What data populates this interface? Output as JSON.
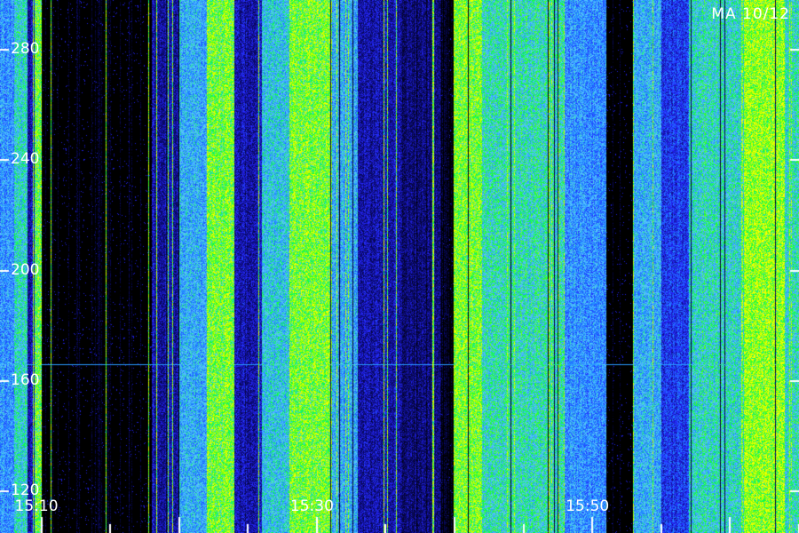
{
  "chart_data": {
    "type": "heatmap",
    "title": "",
    "corner_label": "MA 10/12",
    "xlabel": "",
    "ylabel": "",
    "x_ticks": [
      "15:10",
      "15:30",
      "15:50"
    ],
    "y_ticks": [
      280,
      240,
      200,
      160,
      120
    ],
    "ylim": [
      105,
      298
    ],
    "xlim_minutes": [
      "15:07",
      "16:05"
    ],
    "grid": false,
    "colormap": [
      "#000000",
      "#0a0a6e",
      "#2626ff",
      "#1e90ff",
      "#5fc8ff",
      "#00ff40",
      "#b0ff00",
      "#ffff00"
    ],
    "bands": [
      {
        "x_start": "15:07",
        "x_end": "15:08",
        "intensity": 0.45
      },
      {
        "x_start": "15:08",
        "x_end": "15:09",
        "intensity": 0.6
      },
      {
        "x_start": "15:09",
        "x_end": "15:09:30",
        "intensity": 0.2
      },
      {
        "x_start": "15:09:30",
        "x_end": "15:10",
        "intensity": 0.75
      },
      {
        "x_start": "15:10",
        "x_end": "15:18",
        "intensity": 0.02
      },
      {
        "x_start": "15:18",
        "x_end": "15:20",
        "intensity": 0.2
      },
      {
        "x_start": "15:20",
        "x_end": "15:22",
        "intensity": 0.5
      },
      {
        "x_start": "15:22",
        "x_end": "15:24",
        "intensity": 0.8
      },
      {
        "x_start": "15:24",
        "x_end": "15:26",
        "intensity": 0.2
      },
      {
        "x_start": "15:26",
        "x_end": "15:28",
        "intensity": 0.55
      },
      {
        "x_start": "15:28",
        "x_end": "15:31",
        "intensity": 0.8
      },
      {
        "x_start": "15:31",
        "x_end": "15:33",
        "intensity": 0.5
      },
      {
        "x_start": "15:33",
        "x_end": "15:36",
        "intensity": 0.2
      },
      {
        "x_start": "15:36",
        "x_end": "15:39",
        "intensity": 0.15
      },
      {
        "x_start": "15:39",
        "x_end": "15:40",
        "intensity": 0.05
      },
      {
        "x_start": "15:40",
        "x_end": "15:42",
        "intensity": 0.8
      },
      {
        "x_start": "15:42",
        "x_end": "15:48",
        "intensity": 0.62
      },
      {
        "x_start": "15:48",
        "x_end": "15:51",
        "intensity": 0.45
      },
      {
        "x_start": "15:51",
        "x_end": "15:53",
        "intensity": 0.02
      },
      {
        "x_start": "15:53",
        "x_end": "15:55",
        "intensity": 0.5
      },
      {
        "x_start": "15:55",
        "x_end": "15:57",
        "intensity": 0.3
      },
      {
        "x_start": "15:57",
        "x_end": "16:01",
        "intensity": 0.6
      },
      {
        "x_start": "16:01",
        "x_end": "16:04",
        "intensity": 0.85
      },
      {
        "x_start": "16:04",
        "x_end": "16:05",
        "intensity": 0.6
      }
    ],
    "horizontal_line_y": 166
  }
}
